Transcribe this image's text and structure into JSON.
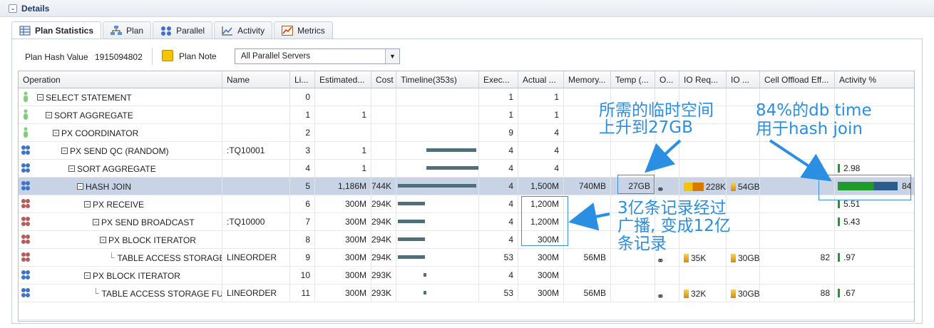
{
  "header": {
    "title": "Details"
  },
  "tabs": [
    {
      "label": "Plan Statistics",
      "icon": "table-icon"
    },
    {
      "label": "Plan",
      "icon": "plan-tree-icon"
    },
    {
      "label": "Parallel",
      "icon": "parallel-icon"
    },
    {
      "label": "Activity",
      "icon": "activity-chart-icon"
    },
    {
      "label": "Metrics",
      "icon": "metrics-chart-icon"
    }
  ],
  "toolbar": {
    "plan_hash_label": "Plan Hash Value",
    "plan_hash_value": "1915094802",
    "plan_note_label": "Plan Note",
    "servers_select": "All Parallel Servers"
  },
  "columns": [
    "Operation",
    "Name",
    "Li...",
    "Estimated...",
    "Cost",
    "Timeline(353s)",
    "Exec...",
    "Actual ...",
    "Memory...",
    "Temp (...",
    "O...",
    "IO Req...",
    "IO ...",
    "Cell Offload Eff...",
    "Activity %"
  ],
  "rows": [
    {
      "op": "SELECT STATEMENT",
      "name": "",
      "line": "0",
      "est": "",
      "cost": "",
      "exec": "1",
      "actual": "1",
      "mem": "",
      "temp": "",
      "ioreq": "",
      "io": "",
      "offload": "",
      "activity": ""
    },
    {
      "op": "SORT AGGREGATE",
      "name": "",
      "line": "1",
      "est": "1",
      "cost": "",
      "exec": "1",
      "actual": "1",
      "mem": "",
      "temp": "",
      "ioreq": "",
      "io": "",
      "offload": "",
      "activity": ""
    },
    {
      "op": "PX COORDINATOR",
      "name": "",
      "line": "2",
      "est": "",
      "cost": "",
      "exec": "9",
      "actual": "4",
      "mem": "",
      "temp": "",
      "ioreq": "",
      "io": "",
      "offload": "",
      "activity": ""
    },
    {
      "op": "PX SEND QC (RANDOM)",
      "name": ":TQ10001",
      "line": "3",
      "est": "1",
      "cost": "",
      "exec": "4",
      "actual": "4",
      "mem": "",
      "temp": "",
      "ioreq": "",
      "io": "",
      "offload": "",
      "activity": ""
    },
    {
      "op": "SORT AGGREGATE",
      "name": "",
      "line": "4",
      "est": "1",
      "cost": "",
      "exec": "4",
      "actual": "4",
      "mem": "",
      "temp": "",
      "ioreq": "",
      "io": "",
      "offload": "",
      "activity": "2.98"
    },
    {
      "op": "HASH JOIN",
      "name": "",
      "line": "5",
      "est": "1,186M",
      "cost": "744K",
      "exec": "4",
      "actual": "1,500M",
      "mem": "740MB",
      "temp": "27GB",
      "ioreq": "228K",
      "io": "54GB",
      "offload": "",
      "activity": "84"
    },
    {
      "op": "PX RECEIVE",
      "name": "",
      "line": "6",
      "est": "300M",
      "cost": "294K",
      "exec": "4",
      "actual": "1,200M",
      "mem": "",
      "temp": "",
      "ioreq": "",
      "io": "",
      "offload": "",
      "activity": "5.51"
    },
    {
      "op": "PX SEND BROADCAST",
      "name": ":TQ10000",
      "line": "7",
      "est": "300M",
      "cost": "294K",
      "exec": "4",
      "actual": "1,200M",
      "mem": "",
      "temp": "",
      "ioreq": "",
      "io": "",
      "offload": "",
      "activity": "5.43"
    },
    {
      "op": "PX BLOCK ITERATOR",
      "name": "",
      "line": "8",
      "est": "300M",
      "cost": "294K",
      "exec": "4",
      "actual": "300M",
      "mem": "",
      "temp": "",
      "ioreq": "",
      "io": "",
      "offload": "",
      "activity": ""
    },
    {
      "op": "TABLE ACCESS STORAGE ...",
      "name": "LINEORDER",
      "line": "9",
      "est": "300M",
      "cost": "294K",
      "exec": "53",
      "actual": "300M",
      "mem": "56MB",
      "temp": "",
      "ioreq": "35K",
      "io": "30GB",
      "offload": "82",
      "activity": ".97"
    },
    {
      "op": "PX BLOCK ITERATOR",
      "name": "",
      "line": "10",
      "est": "300M",
      "cost": "293K",
      "exec": "4",
      "actual": "300M",
      "mem": "",
      "temp": "",
      "ioreq": "",
      "io": "",
      "offload": "",
      "activity": ""
    },
    {
      "op": "TABLE ACCESS STORAGE FULL",
      "name": "LINEORDER",
      "line": "11",
      "est": "300M",
      "cost": "293K",
      "exec": "53",
      "actual": "300M",
      "mem": "56MB",
      "temp": "",
      "ioreq": "32K",
      "io": "30GB",
      "offload": "88",
      "activity": ".67"
    }
  ],
  "annotations": {
    "temp_note_line1": "所需的临时空间",
    "temp_note_line2": "上升到27GB",
    "dbtime_note_line1": "84%的db time",
    "dbtime_note_line2": "用于hash join",
    "broadcast_note_line1": "3亿条记录经过",
    "broadcast_note_line2": "广播, 变成12亿",
    "broadcast_note_line3": "条记录"
  },
  "colors": {
    "accent": "#2a8fe3",
    "selected_row": "#c9d3e6",
    "activity_bar": "#1e9b2a",
    "timeline_bar": "#4f6f78"
  }
}
